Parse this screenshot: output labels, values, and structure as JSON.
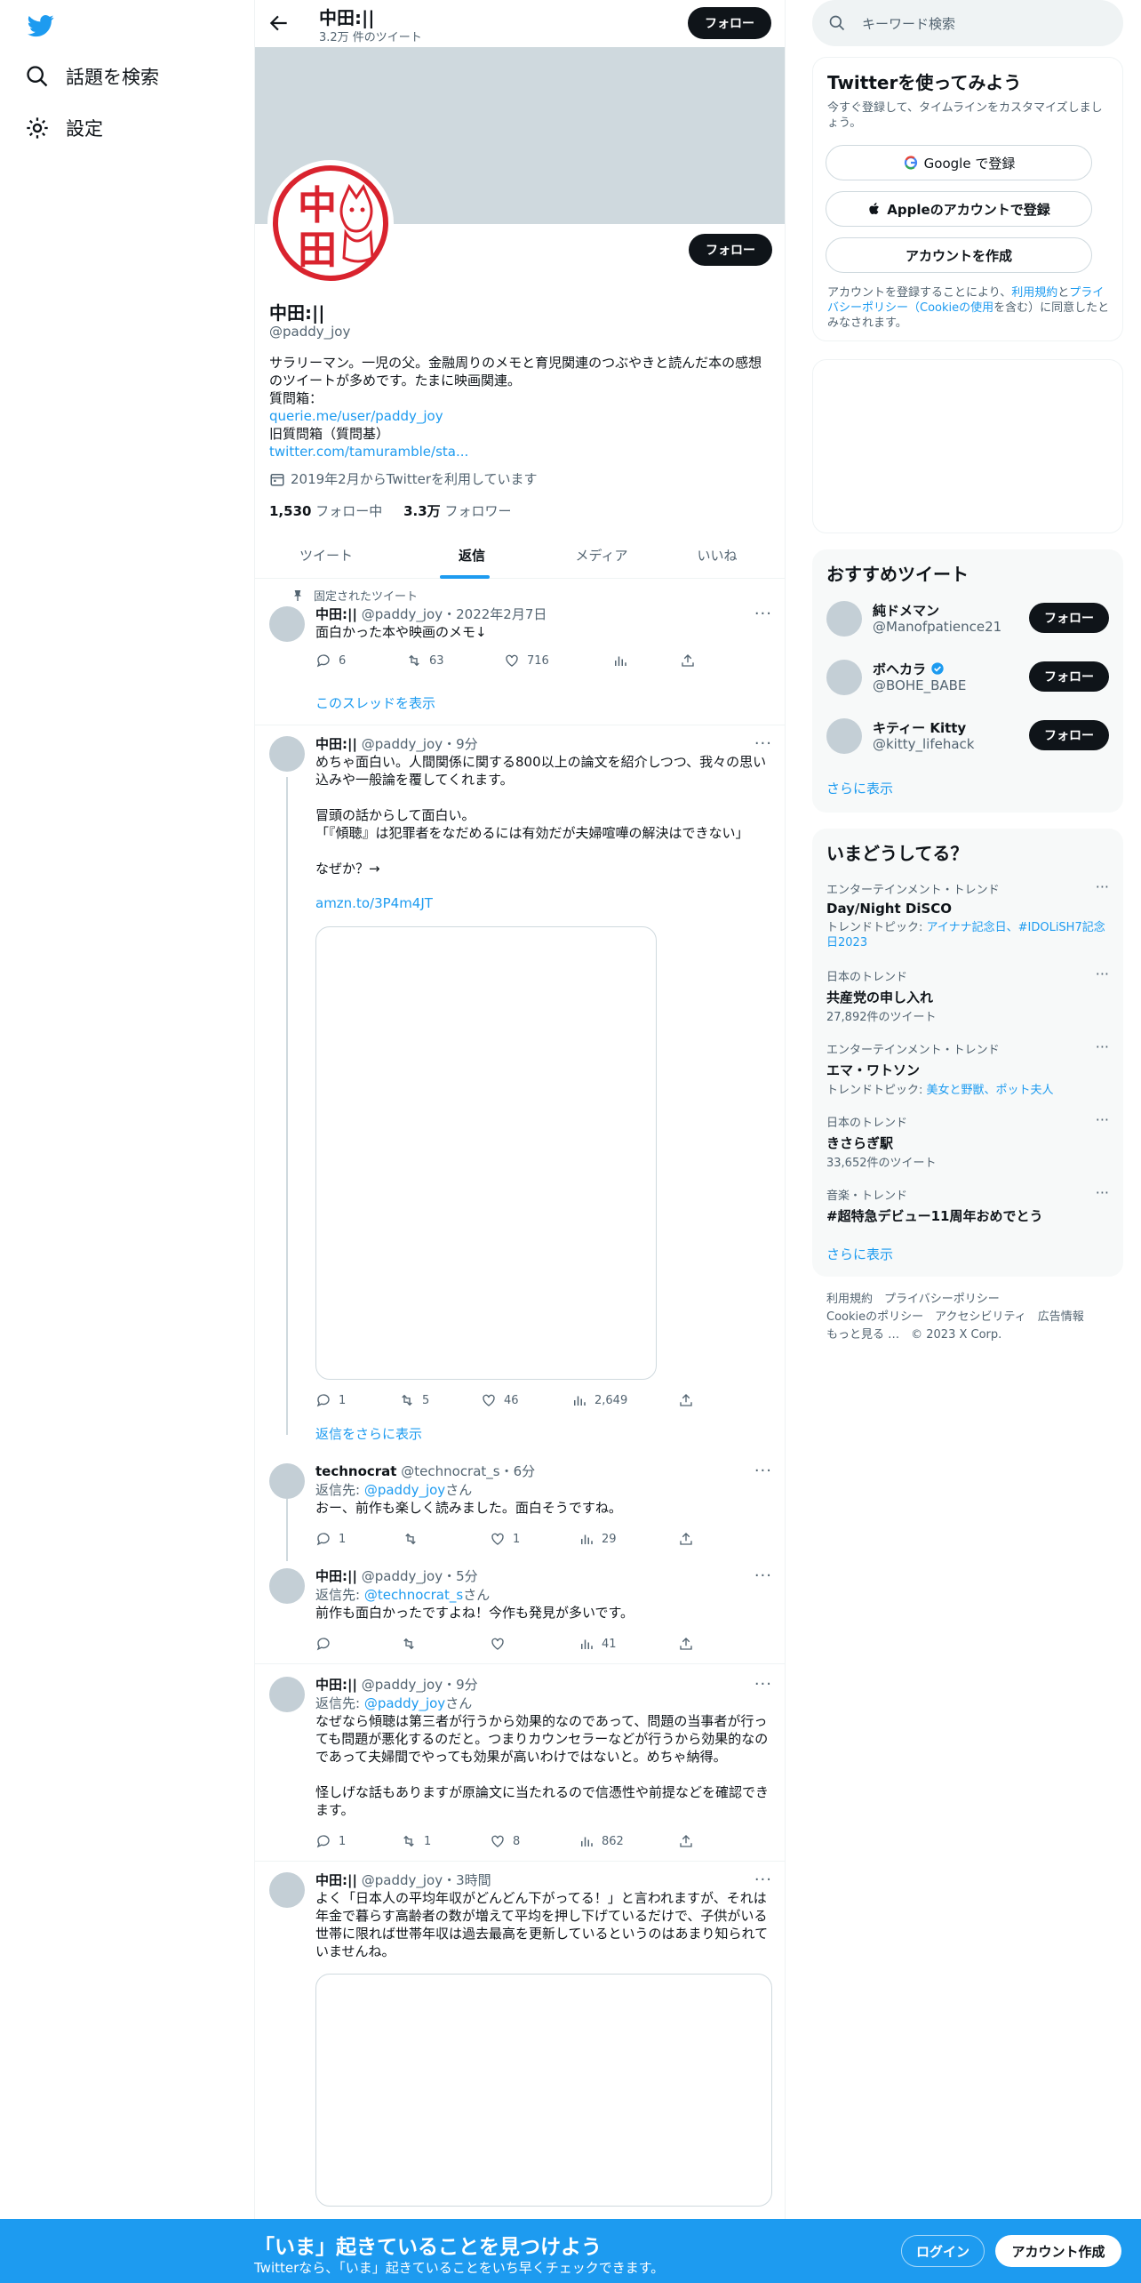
{
  "nav": {
    "explore_label": "話題を検索",
    "settings_label": "設定"
  },
  "header": {
    "name": "中田:||",
    "tweet_count": "3.2万 件のツイート",
    "follow_label": "フォロー"
  },
  "profile": {
    "name": "中田:||",
    "handle": "@paddy_joy",
    "follow_label": "フォロー",
    "bio_lines": [
      "サラリーマン。一児の父。金融周りのメモと育児関連のつぶやきと読んだ本の感想",
      "のツイートが多めです。たまに映画関連。",
      "質問箱："
    ],
    "link1": "querie.me/user/paddy_joy",
    "old_qbox": "旧質問箱（質問基）",
    "link2": "twitter.com/tamuramble/sta...",
    "joined": "2019年2月からTwitterを利用しています",
    "following_count": "1,530",
    "following_label": "フォロー中",
    "followers_count": "3.3万",
    "followers_label": "フォロワー"
  },
  "tabs": [
    "ツイート",
    "返信",
    "メディア",
    "いいね"
  ],
  "tweets": [
    {
      "pinned_label": "固定されたツイート",
      "name": "中田:||",
      "meta": "@paddy_joy・2022年2月7日",
      "text": "面白かった本や映画のメモ↓",
      "replies": "6",
      "retweets": "63",
      "likes": "716",
      "views": "",
      "show_thread": "このスレッドを表示"
    },
    {
      "name": "中田:||",
      "meta": "@paddy_joy・9分",
      "text": "めちゃ面白い。人間関係に関する800以上の論文を紹介しつつ、我々の思い\n込みや一般論を覆してくれます。\n\n冒頭の話からして面白い。\n「『傾聴』は犯罪者をなだめるには有効だが夫婦喧嘩の解決はできない」\n\nなぜか？→",
      "link": "amzn.to/3P4m4JT",
      "replies": "1",
      "retweets": "5",
      "likes": "46",
      "views": "2,649",
      "show_more": "返信をさらに表示"
    },
    {
      "name": "technocrat",
      "meta": "@technocrat_s・6分",
      "reply_prefix": "返信先: ",
      "reply_to": "@paddy_joy",
      "reply_suffix": "さん",
      "text": "おー、前作も楽しく読みました。面白そうですね。",
      "replies": "1",
      "retweets": "",
      "likes": "1",
      "views": "29"
    },
    {
      "name": "中田:||",
      "meta": "@paddy_joy・5分",
      "reply_prefix": "返信先: ",
      "reply_to": "@technocrat_s",
      "reply_suffix": "さん",
      "text": "前作も面白かったですよね！今作も発見が多いです。",
      "replies": "",
      "retweets": "",
      "likes": "",
      "views": "41"
    },
    {
      "name": "中田:||",
      "meta": "@paddy_joy・9分",
      "reply_prefix": "返信先: ",
      "reply_to": "@paddy_joy",
      "reply_suffix": "さん",
      "text": "なぜなら傾聴は第三者が行うから効果的なのであって、問題の当事者が行っ\nても問題が悪化するのだと。つまりカウンセラーなどが行うから効果的なの\nであって夫婦間でやっても効果が高いわけではないと。めちゃ納得。\n\n怪しげな話もありますが原論文に当たれるので信憑性や前提などを確認でき\nます。",
      "replies": "1",
      "retweets": "1",
      "likes": "8",
      "views": "862"
    },
    {
      "name": "中田:||",
      "meta": "@paddy_joy・3時間",
      "text": "よく「日本人の平均年収がどんどん下がってる！」と言われますが、それは\n年金で暮らす高齢者の数が増えて平均を押し下げているだけで、子供がいる\n世帯に限れば世帯年収は過去最高を更新しているというのはあまり知られて\nいませんね。"
    }
  ],
  "sidebar": {
    "search_placeholder": "キーワード検索",
    "signup": {
      "title": "Twitterを使ってみよう",
      "desc": "今すぐ登録して、タイムラインをカスタマイズしましょう。",
      "google_label": "Google で登録",
      "apple_label": "Appleのアカウントで登録",
      "create_label": "アカウントを作成",
      "terms_pre": "アカウントを登録することにより、",
      "terms_link1": "利用規約",
      "terms_mid": "と",
      "terms_link2": "プライバシーポリシー（Cookieの使用",
      "terms_post": "を含む）に同意したとみなされます。"
    },
    "recommended": {
      "title": "おすすめツイート",
      "users": [
        {
          "name": "純ドメマン",
          "handle": "@Manofpatience21",
          "verified": false
        },
        {
          "name": "ボヘカラ",
          "handle": "@BOHE_BABE",
          "verified": true
        },
        {
          "name": "キティー Kitty",
          "handle": "@kitty_lifehack",
          "verified": false
        }
      ],
      "follow_label": "フォロー",
      "show_more": "さらに表示"
    },
    "trends": {
      "title": "いまどうしてる？",
      "items": [
        {
          "context": "エンターテインメント・トレンド",
          "name": "Day/Night DiSCO",
          "sub_prefix": "トレンドトピック: ",
          "sub_links": "アイナナ記念日、#IDOLiSH7記念日2023"
        },
        {
          "context": "日本のトレンド",
          "name": "共産党の申し入れ",
          "sub_prefix": "27,892件のツイート",
          "sub_links": ""
        },
        {
          "context": "エンターテインメント・トレンド",
          "name": "エマ・ワトソン",
          "sub_prefix": "トレンドトピック: ",
          "sub_links": "美女と野獣、ポット夫人"
        },
        {
          "context": "日本のトレンド",
          "name": "きさらぎ駅",
          "sub_prefix": "33,652件のツイート",
          "sub_links": ""
        },
        {
          "context": "音楽・トレンド",
          "name": "#超特急デビュー11周年おめでとう",
          "sub_prefix": "",
          "sub_links": ""
        }
      ],
      "show_more": "さらに表示"
    },
    "footer": {
      "line1": "利用規約　プライバシーポリシー",
      "line2": "Cookieのポリシー　アクセシビリティ　広告情報",
      "line3": "もっと見る …　© 2023 X Corp."
    }
  },
  "bottom_bar": {
    "title": "「いま」起きていることを見つけよう",
    "subtitle": "Twitterなら、「いま」起きていることをいち早くチェックできます。",
    "login_label": "ログイン",
    "signup_label": "アカウント作成"
  },
  "colors": {
    "accent": "#1d9bf0",
    "text": "#0f1419",
    "muted": "#536471",
    "banner": "#cfd9de",
    "avatar_red": "#d9232e"
  }
}
